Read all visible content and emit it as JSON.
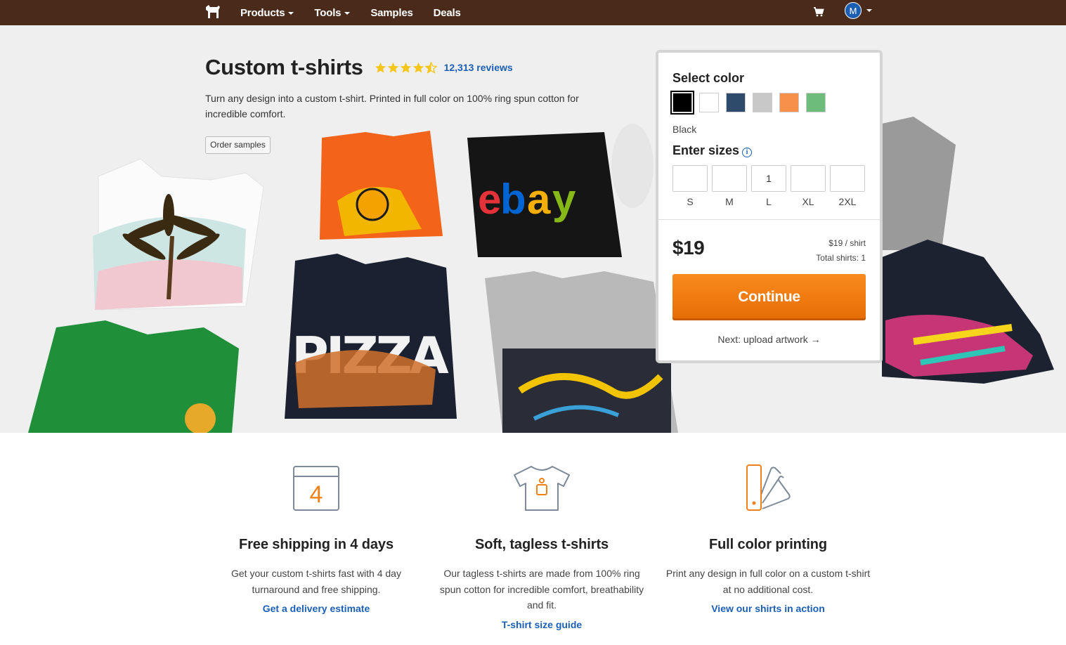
{
  "nav": {
    "logo_icon": "sticker-mule-horse-icon",
    "items": [
      {
        "label": "Products",
        "has_caret": true
      },
      {
        "label": "Tools",
        "has_caret": true
      },
      {
        "label": "Samples",
        "has_caret": false
      },
      {
        "label": "Deals",
        "has_caret": false
      }
    ],
    "cart_icon": "cart-icon",
    "avatar_initial": "M"
  },
  "hero": {
    "title": "Custom t-shirts",
    "rating": 4.5,
    "reviews_label": "12,313 reviews",
    "description": "Turn any design into a custom t-shirt. Printed in full color on 100% ring spun cotton for incredible comfort.",
    "order_samples_label": "Order samples"
  },
  "order_panel": {
    "select_color_label": "Select color",
    "colors": [
      {
        "name": "Black",
        "hex": "#000000",
        "selected": true
      },
      {
        "name": "White",
        "hex": "#ffffff",
        "selected": false
      },
      {
        "name": "Navy",
        "hex": "#2f4b6b",
        "selected": false
      },
      {
        "name": "Gray",
        "hex": "#c8c8c8",
        "selected": false
      },
      {
        "name": "Orange",
        "hex": "#f7904a",
        "selected": false
      },
      {
        "name": "Green",
        "hex": "#6dbc7b",
        "selected": false
      }
    ],
    "selected_color_name": "Black",
    "enter_sizes_label": "Enter sizes",
    "sizes": [
      {
        "label": "S",
        "value": ""
      },
      {
        "label": "M",
        "value": ""
      },
      {
        "label": "L",
        "value": "1"
      },
      {
        "label": "XL",
        "value": ""
      },
      {
        "label": "2XL",
        "value": ""
      }
    ],
    "price": "$19",
    "price_per": "$19 / shirt",
    "total_shirts": "Total shirts: 1",
    "continue_label": "Continue",
    "next_step": "Next: upload artwork →"
  },
  "features": [
    {
      "icon": "calendar-4-icon",
      "title": "Free shipping in 4 days",
      "text": "Get your custom t-shirts fast with 4 day turnaround and free shipping.",
      "link": "Get a delivery estimate"
    },
    {
      "icon": "tshirt-tag-icon",
      "title": "Soft, tagless t-shirts",
      "text": "Our tagless t-shirts are made from 100% ring spun cotton for incredible comfort, breathability and fit.",
      "link": "T-shirt size guide"
    },
    {
      "icon": "color-swatch-fan-icon",
      "title": "Full color printing",
      "text": "Print any design in full color on a custom t-shirt at no additional cost.",
      "link": "View our shirts in action"
    }
  ],
  "calendar_number": "4",
  "colors": {
    "nav_bg": "#4a2a1a",
    "accent_orange": "#f08019",
    "link_blue": "#1b5fb4",
    "star_yellow": "#f5c518"
  }
}
